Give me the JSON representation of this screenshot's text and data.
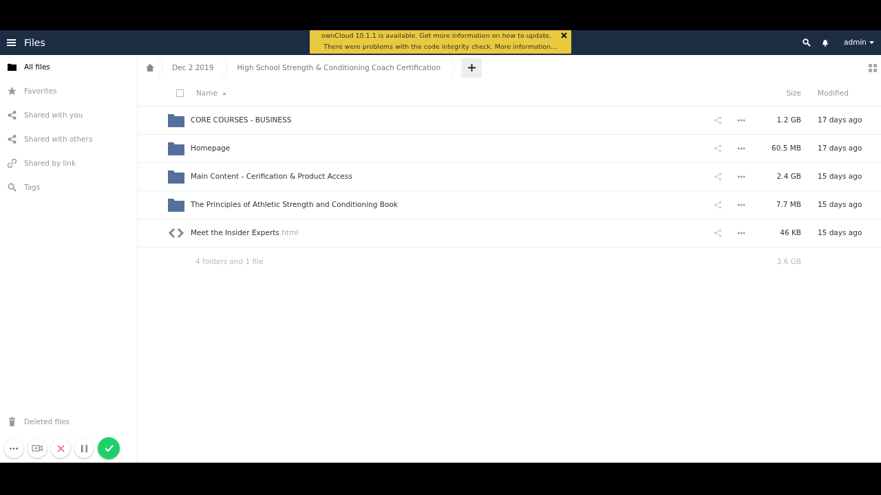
{
  "header": {
    "app_title": "Files",
    "user": "admin"
  },
  "notification": {
    "lines": [
      "ownCloud 10.1.1 is available. Get more information on how to update.",
      "There were problems with the code integrity check. More information…"
    ]
  },
  "sidebar": {
    "items": [
      {
        "label": "All files",
        "kind": "folder",
        "selected": true
      },
      {
        "label": "Favorites",
        "kind": "star",
        "selected": false
      },
      {
        "label": "Shared with you",
        "kind": "share",
        "selected": false
      },
      {
        "label": "Shared with others",
        "kind": "share",
        "selected": false
      },
      {
        "label": "Shared by link",
        "kind": "link",
        "selected": false
      },
      {
        "label": "Tags",
        "kind": "search",
        "selected": false
      }
    ],
    "footer_items": [
      {
        "label": "Deleted files",
        "kind": "trash"
      }
    ]
  },
  "breadcrumbs": [
    "Dec 2 2019",
    "High School Strength & Conditioning Coach Certification"
  ],
  "table": {
    "columns": [
      "Name",
      "Size",
      "Modified"
    ],
    "select_all": {
      "checked": false
    },
    "rows": [
      {
        "kind": "folder",
        "name": "CORE COURSES - BUSINESS",
        "size": "1.2 GB",
        "modified": "17 days ago"
      },
      {
        "kind": "folder",
        "name": "Homepage",
        "size": "60.5 MB",
        "modified": "17 days ago"
      },
      {
        "kind": "folder",
        "name": "Main Content - Cerification & Product Access",
        "size": "2.4 GB",
        "modified": "15 days ago"
      },
      {
        "kind": "folder",
        "name": "The Principles of Athletic Strength and Conditioning Book",
        "size": "7.7 MB",
        "modified": "15 days ago"
      },
      {
        "kind": "code",
        "name": "Meet the Insider Experts",
        "extension": ".html",
        "size": "46 KB",
        "modified": "15 days ago"
      }
    ],
    "summary": {
      "text": "4 folders and 1 file",
      "size": "3.6 GB"
    }
  },
  "recorder": {
    "buttons": [
      {
        "kind": "more"
      },
      {
        "kind": "camera"
      },
      {
        "kind": "cancel"
      },
      {
        "kind": "pause"
      },
      {
        "kind": "done"
      }
    ]
  }
}
